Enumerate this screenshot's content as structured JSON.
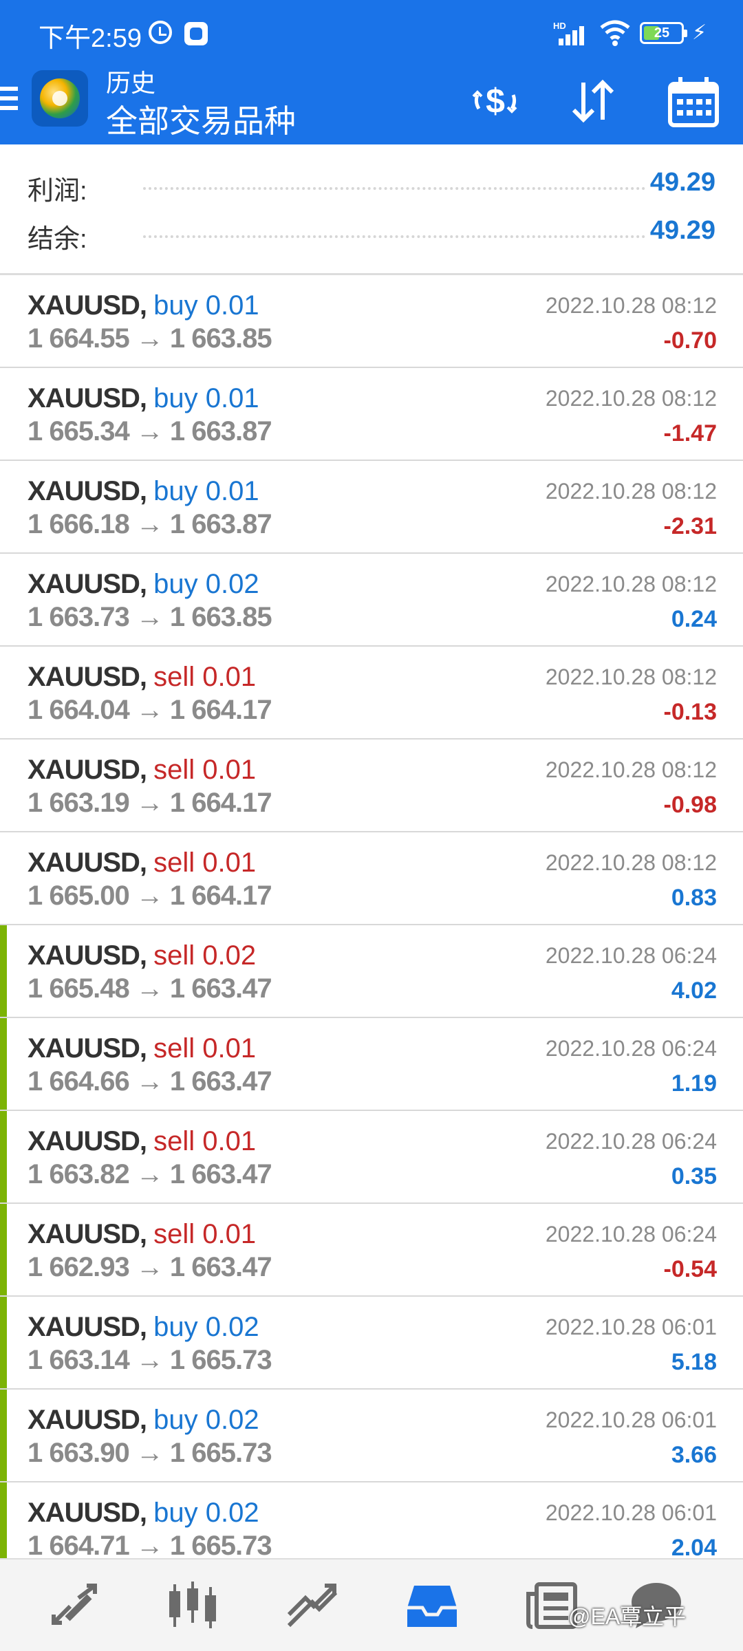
{
  "status_bar": {
    "time": "下午2:59",
    "network": "HD",
    "battery": "25"
  },
  "header": {
    "subtitle": "历史",
    "title": "全部交易品种"
  },
  "summary": {
    "profit_label": "利润:",
    "profit_value": "49.29",
    "balance_label": "结余:",
    "balance_value": "49.29"
  },
  "trades": [
    {
      "symbol": "XAUUSD,",
      "type": "buy 0.01",
      "prices": "1 664.55 → 1 663.85",
      "datetime": "2022.10.28 08:12",
      "profit": "-0.70"
    },
    {
      "symbol": "XAUUSD,",
      "type": "buy 0.01",
      "prices": "1 665.34 → 1 663.87",
      "datetime": "2022.10.28 08:12",
      "profit": "-1.47"
    },
    {
      "symbol": "XAUUSD,",
      "type": "buy 0.01",
      "prices": "1 666.18 → 1 663.87",
      "datetime": "2022.10.28 08:12",
      "profit": "-2.31"
    },
    {
      "symbol": "XAUUSD,",
      "type": "buy 0.02",
      "prices": "1 663.73 → 1 663.85",
      "datetime": "2022.10.28 08:12",
      "profit": "0.24"
    },
    {
      "symbol": "XAUUSD,",
      "type": "sell 0.01",
      "prices": "1 664.04 → 1 664.17",
      "datetime": "2022.10.28 08:12",
      "profit": "-0.13"
    },
    {
      "symbol": "XAUUSD,",
      "type": "sell 0.01",
      "prices": "1 663.19 → 1 664.17",
      "datetime": "2022.10.28 08:12",
      "profit": "-0.98"
    },
    {
      "symbol": "XAUUSD,",
      "type": "sell 0.01",
      "prices": "1 665.00 → 1 664.17",
      "datetime": "2022.10.28 08:12",
      "profit": "0.83"
    },
    {
      "symbol": "XAUUSD,",
      "type": "sell 0.02",
      "prices": "1 665.48 → 1 663.47",
      "datetime": "2022.10.28 06:24",
      "profit": "4.02"
    },
    {
      "symbol": "XAUUSD,",
      "type": "sell 0.01",
      "prices": "1 664.66 → 1 663.47",
      "datetime": "2022.10.28 06:24",
      "profit": "1.19"
    },
    {
      "symbol": "XAUUSD,",
      "type": "sell 0.01",
      "prices": "1 663.82 → 1 663.47",
      "datetime": "2022.10.28 06:24",
      "profit": "0.35"
    },
    {
      "symbol": "XAUUSD,",
      "type": "sell 0.01",
      "prices": "1 662.93 → 1 663.47",
      "datetime": "2022.10.28 06:24",
      "profit": "-0.54"
    },
    {
      "symbol": "XAUUSD,",
      "type": "buy 0.02",
      "prices": "1 663.14 → 1 665.73",
      "datetime": "2022.10.28 06:01",
      "profit": "5.18"
    },
    {
      "symbol": "XAUUSD,",
      "type": "buy 0.02",
      "prices": "1 663.90 → 1 665.73",
      "datetime": "2022.10.28 06:01",
      "profit": "3.66"
    },
    {
      "symbol": "XAUUSD,",
      "type": "buy 0.02",
      "prices": "1 664.71 → 1 665.73",
      "datetime": "2022.10.28 06:01",
      "profit": "2.04"
    }
  ],
  "colors": {
    "header_bg": "#1a73e8",
    "buy": "#1976d2",
    "sell": "#c62828",
    "positive": "#1976d2",
    "negative": "#c62828",
    "session_marker": "#7cb305"
  },
  "bottom_nav": {
    "items": [
      "quotes-icon",
      "chart-icon",
      "trade-icon",
      "history-icon",
      "news-icon",
      "messages-icon"
    ],
    "watermark": "@EA覃立平"
  }
}
